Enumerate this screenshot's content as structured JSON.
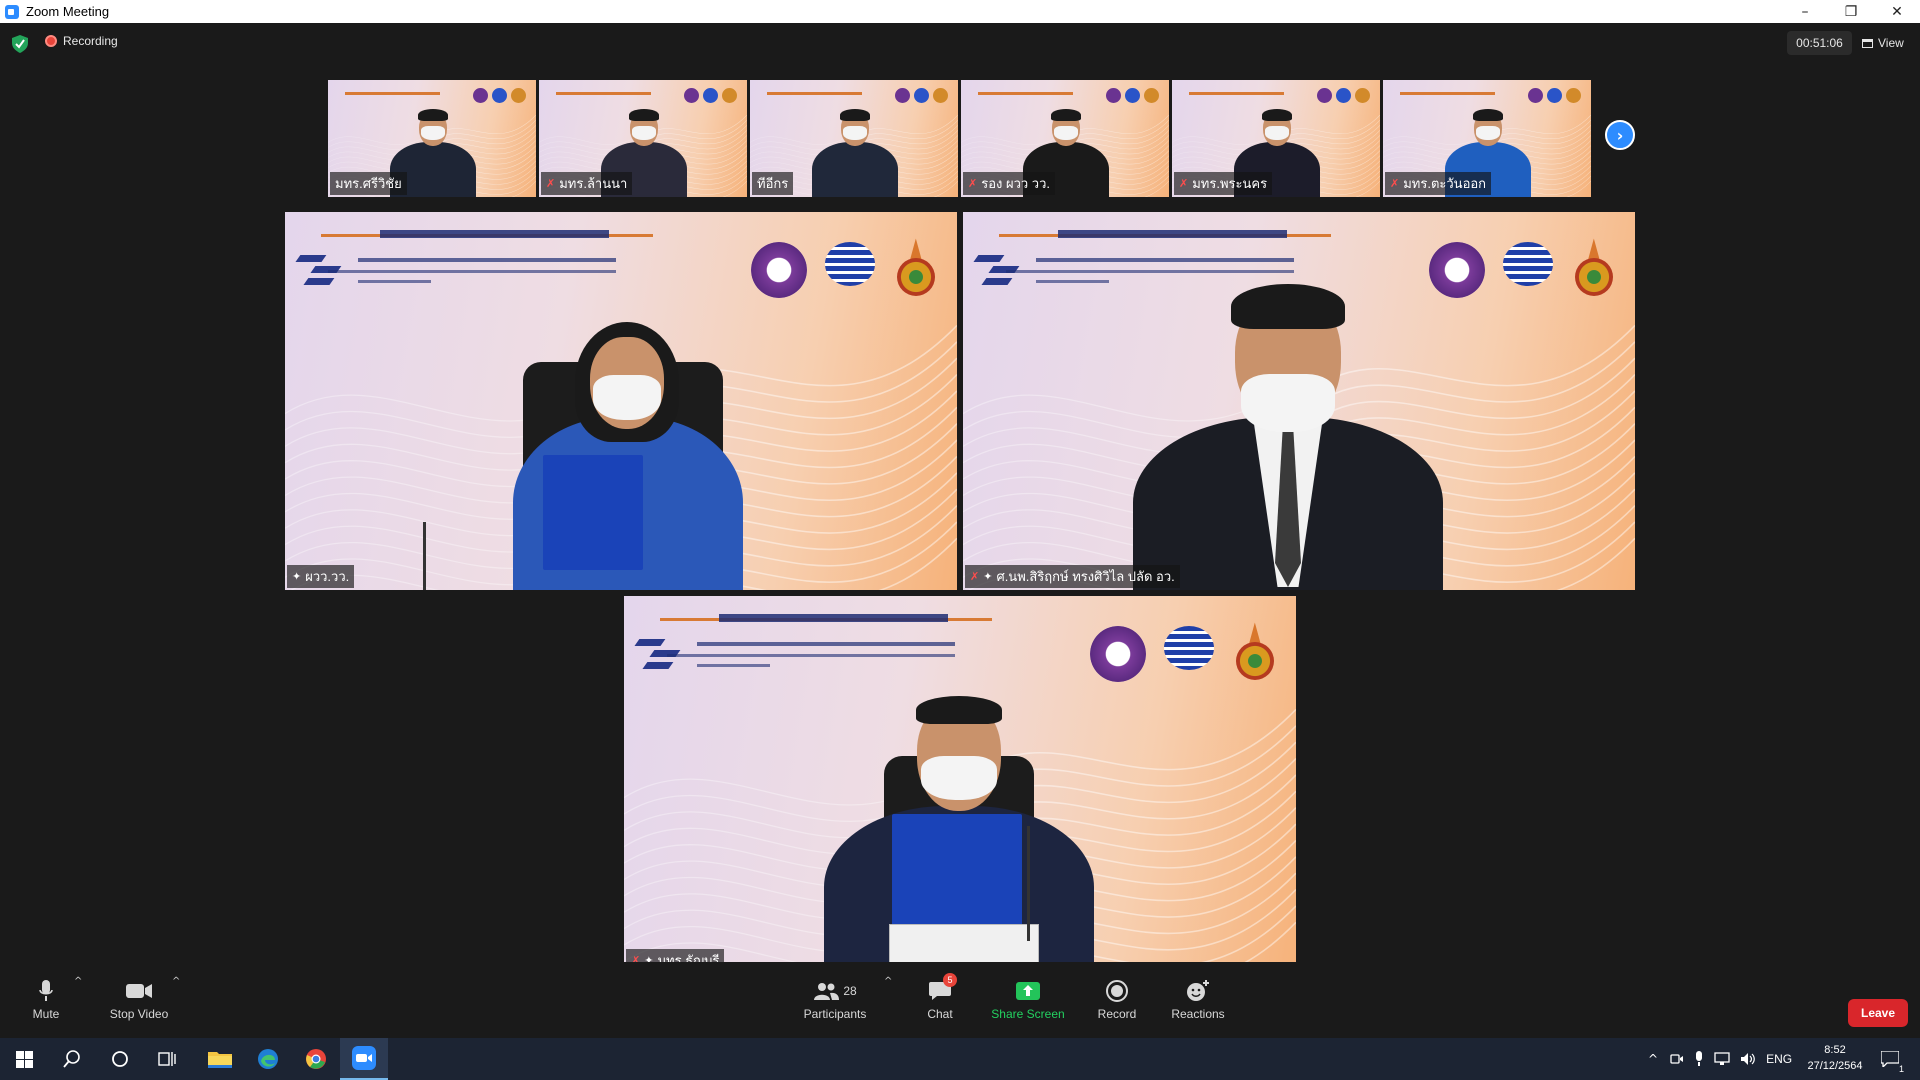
{
  "window": {
    "title": "Zoom Meeting",
    "controls": [
      "–",
      "❐",
      "✕"
    ]
  },
  "meeting": {
    "recording_label": "Recording",
    "timer": "00:51:06",
    "view_label": "View",
    "accent": "#2d8cff"
  },
  "thumbnails": [
    {
      "name": "มทร.ศรีวิชัย",
      "muted": false,
      "pinned": false
    },
    {
      "name": "มทร.ล้านนา",
      "muted": true,
      "pinned": false
    },
    {
      "name": "ทีอีกร",
      "muted": false,
      "pinned": false
    },
    {
      "name": "รอง ผวว วว.",
      "muted": true,
      "pinned": false
    },
    {
      "name": "มทร.พระนคร",
      "muted": true,
      "pinned": false
    },
    {
      "name": "มทร.ตะวันออก",
      "muted": true,
      "pinned": false
    }
  ],
  "stage": [
    {
      "name": "ผวว.วว.",
      "muted": false,
      "pinned": true
    },
    {
      "name": "ศ.นพ.สิริฤกษ์ ทรงศิวิไล ปลัด อว.",
      "muted": true,
      "pinned": true
    },
    {
      "name": "มทร.ธัญบุรี",
      "muted": true,
      "pinned": true
    }
  ],
  "toolbar": {
    "mute_label": "Mute",
    "stop_video_label": "Stop Video",
    "participants_label": "Participants",
    "participants_count": "28",
    "chat_label": "Chat",
    "chat_badge": "5",
    "share_label": "Share Screen",
    "record_label": "Record",
    "reactions_label": "Reactions",
    "leave_label": "Leave"
  },
  "taskbar": {
    "lang": "ENG",
    "time": "8:52",
    "date": "27/12/2564",
    "notif_count": "1"
  }
}
